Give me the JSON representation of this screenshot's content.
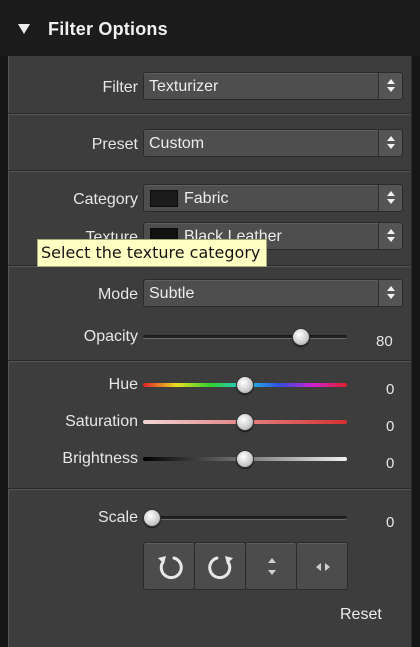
{
  "panel": {
    "title": "Filter Options",
    "filter": {
      "label": "Filter",
      "value": "Texturizer"
    },
    "preset": {
      "label": "Preset",
      "value": "Custom"
    },
    "category": {
      "label": "Category",
      "value": "Fabric"
    },
    "texture": {
      "label": "Texture",
      "value": "Black Leather"
    },
    "tooltip": "Select the texture category",
    "mode": {
      "label": "Mode",
      "value": "Subtle"
    },
    "opacity": {
      "label": "Opacity",
      "value": "80",
      "level": 0.8
    },
    "hue": {
      "label": "Hue",
      "value": "0",
      "level": 0.5
    },
    "saturation": {
      "label": "Saturation",
      "value": "0",
      "level": 0.5
    },
    "brightness": {
      "label": "Brightness",
      "value": "0",
      "level": 0.5
    },
    "scale": {
      "label": "Scale",
      "value": "0",
      "level": 0.0
    },
    "buttons": {
      "rotate_left": "rotate-left-icon",
      "rotate_right": "rotate-right-icon",
      "flip_vertical": "flip-vertical-icon",
      "flip_horizontal": "flip-horizontal-icon"
    },
    "reset_label": "Reset"
  }
}
